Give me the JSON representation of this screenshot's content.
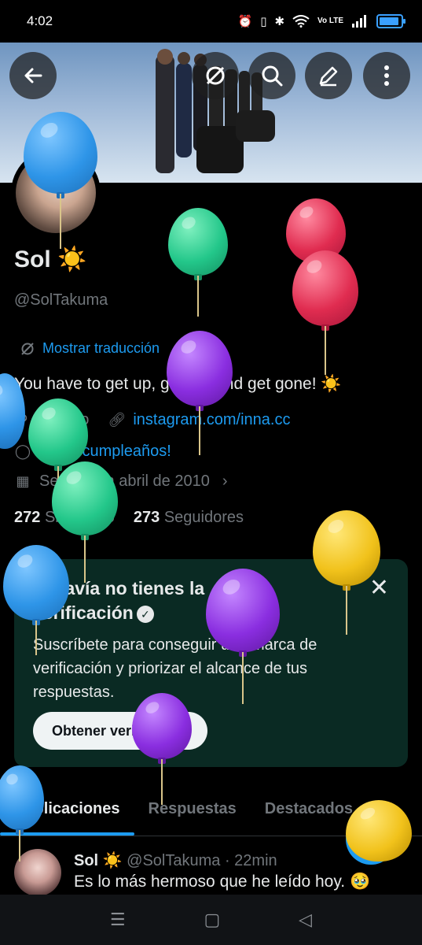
{
  "status_bar": {
    "time": "4:02",
    "network": "Vo LTE"
  },
  "header": {
    "back_icon": "back-arrow-icon",
    "translate_icon": "translate-icon",
    "search_icon": "search-icon",
    "edit_icon": "edit-icon",
    "more_icon": "more-vertical-icon"
  },
  "profile": {
    "name": "Sol ☀️",
    "handle": "@SolTakuma",
    "translate_label": "Mostrar traducción",
    "bio": "You have to get up, get out and get gone! ☀️",
    "location": "México",
    "website": "instagram.com/inna.cc",
    "birthday": "¡Feliz cumpleaños!",
    "joined": "Se unió en abril de 2010",
    "following_count": "272",
    "following_label": "Siguiendo",
    "followers_count": "273",
    "followers_label": "Seguidores"
  },
  "verification_card": {
    "title": "Todavía no tienes la verificación",
    "description": "Suscríbete para conseguir una marca de verificación y priorizar el alcance de tus respuestas.",
    "button_label": "Obtener verificación"
  },
  "tabs": [
    {
      "label": "Publicaciones",
      "active": true
    },
    {
      "label": "Respuestas",
      "active": false
    },
    {
      "label": "Destacados",
      "active": false
    }
  ],
  "tweet": {
    "author": "Sol ☀️",
    "handle": "@SolTakuma",
    "time": "22min",
    "text": "Es lo más hermoso que he leído hoy. 🥹"
  },
  "fab": {
    "icon": "plus-icon"
  },
  "colors": {
    "accent": "#1d9bf0",
    "card_bg": "#0a2a23",
    "muted": "#71767b"
  }
}
